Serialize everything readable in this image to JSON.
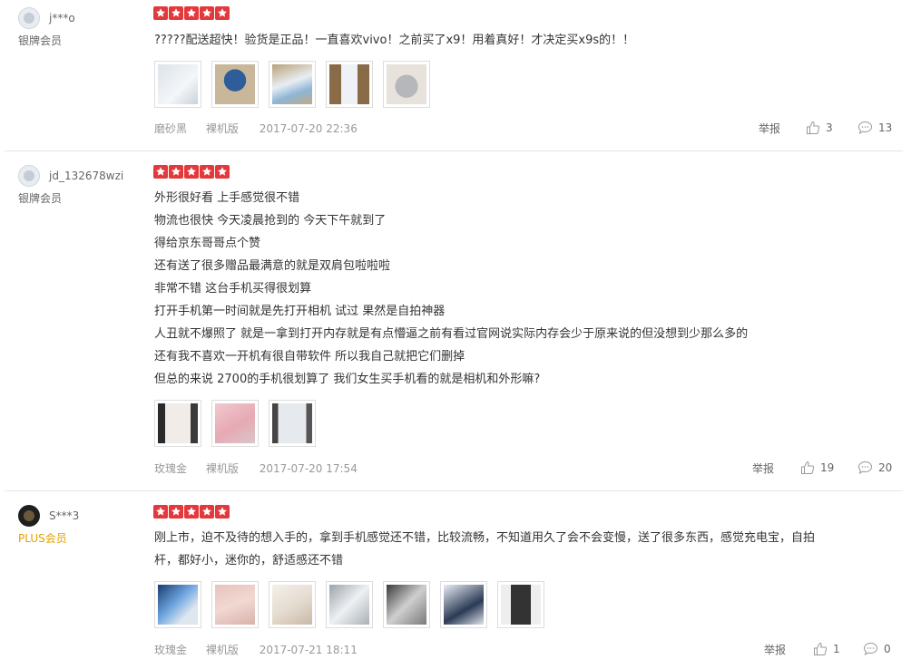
{
  "reviews": [
    {
      "user": "j***o",
      "member": "银牌会员",
      "stars": 5,
      "text": [
        "?????配送超快！验货是正品！一直喜欢vivo！之前买了x9！用着真好！才决定买x9s的！！"
      ],
      "variant": "磨砂黑",
      "edition": "裸机版",
      "date": "2017-07-20 22:36",
      "report": "举报",
      "likes": "3",
      "comments": "13"
    },
    {
      "user": "jd_132678wzi",
      "member": "银牌会员",
      "stars": 5,
      "text": [
        "外形很好看 上手感觉很不错",
        "物流也很快 今天凌晨抢到的 今天下午就到了",
        "得给京东哥哥点个赞",
        "还有送了很多赠品最满意的就是双肩包啦啦啦",
        "非常不错 这台手机买得很划算",
        "打开手机第一时间就是先打开相机 试过 果然是自拍神器",
        "人丑就不爆照了 就是一拿到打开内存就是有点懵逼之前有看过官网说实际内存会少于原来说的但没想到少那么多的",
        "还有我不喜欢一开机有很自带软件 所以我自己就把它们删掉",
        "但总的来说 2700的手机很划算了 我们女生买手机看的就是相机和外形嘛?"
      ],
      "variant": "玫瑰金",
      "edition": "裸机版",
      "date": "2017-07-20 17:54",
      "report": "举报",
      "likes": "19",
      "comments": "20"
    },
    {
      "user": "S***3",
      "member": "PLUS会员",
      "stars": 5,
      "text": [
        "刚上市，迫不及待的想入手的，拿到手机感觉还不错，比较流畅，不知道用久了会不会变慢，送了很多东西，感觉充电宝，自拍",
        "杆，都好小，迷你的，舒适感还不错"
      ],
      "variant": "玫瑰金",
      "edition": "裸机版",
      "date": "2017-07-21 18:11",
      "report": "举报",
      "likes": "1",
      "comments": "0"
    }
  ],
  "colors": {
    "star": "#e4393c",
    "plus": "#e1a200",
    "meta": "#999999"
  }
}
